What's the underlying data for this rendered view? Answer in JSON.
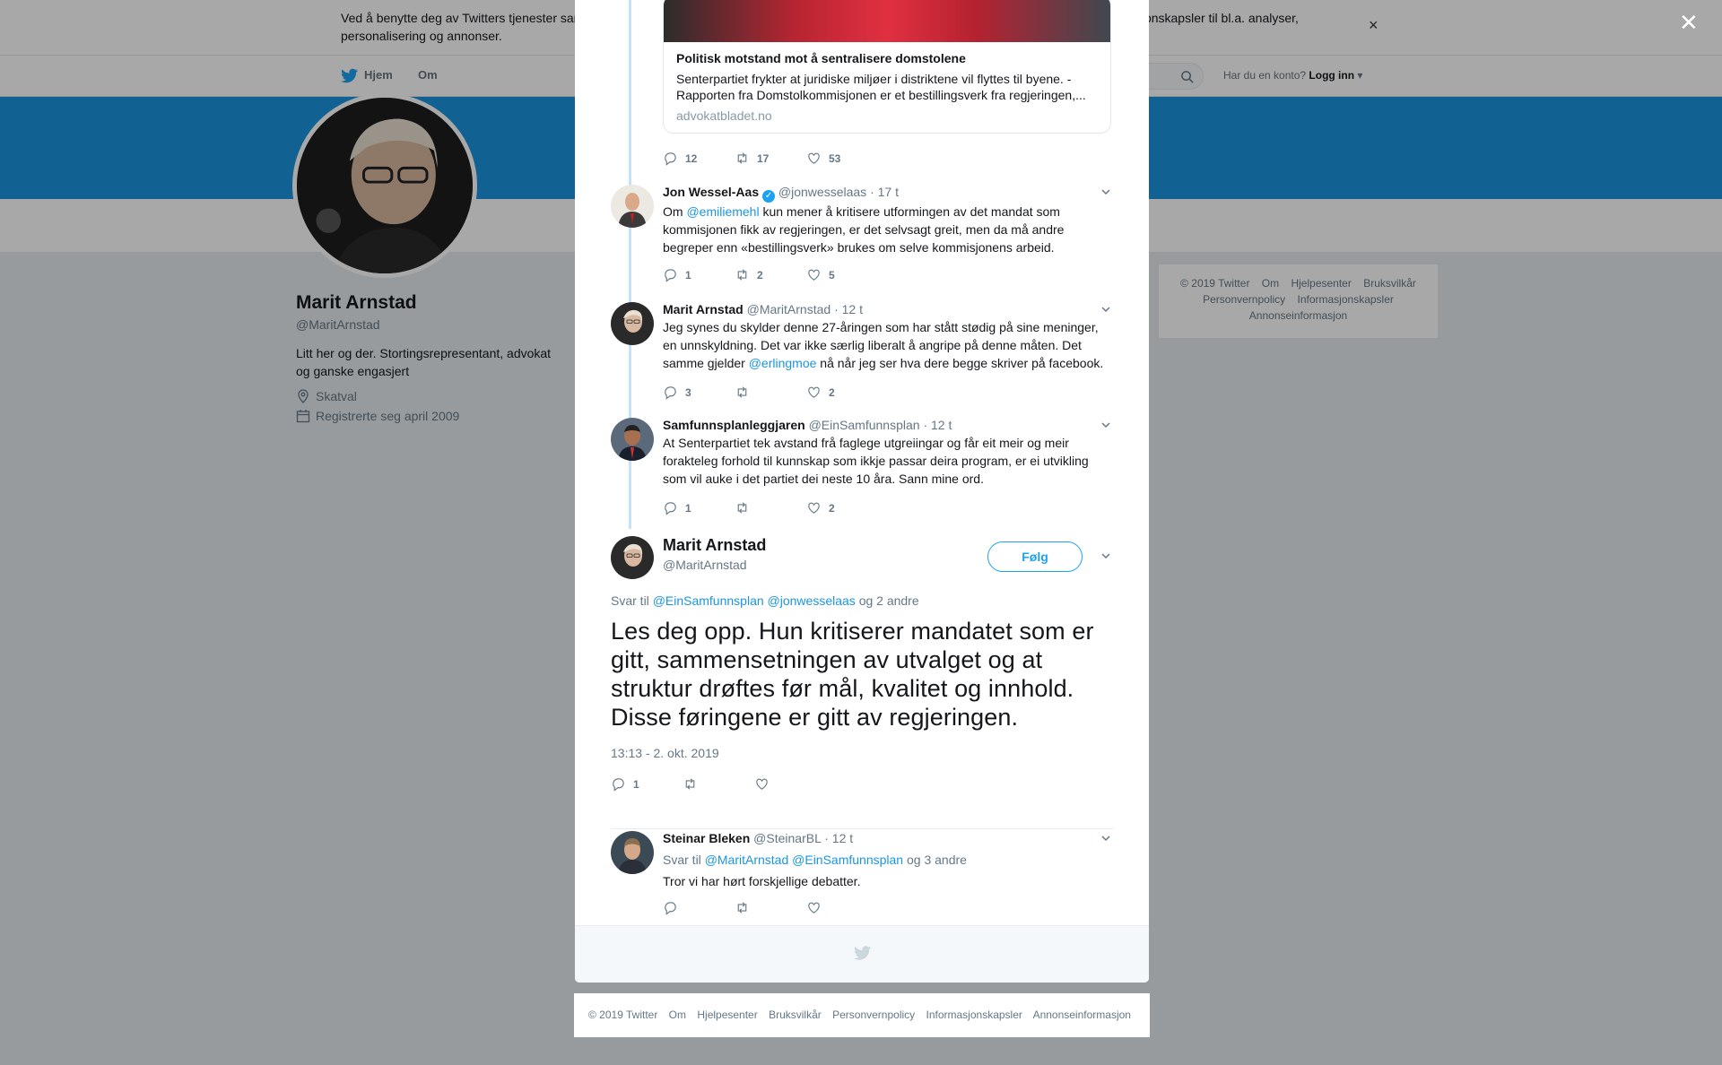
{
  "cookie_banner": {
    "text": "Ved å benytte deg av Twitters tjenester samtykker du i vår bruk av informasjonskapsler. Twitter og partnere fungerer globalt og benytter informasjonskapsler til bl.a. analyser, personalisering og annonser."
  },
  "topnav": {
    "home": "Hjem",
    "about": "Om",
    "login_question": "Har du en konto?",
    "login": "Logg inn"
  },
  "profile": {
    "name": "Marit Arnstad",
    "handle": "@MaritArnstad",
    "bio": "Litt her og der. Stortingsrepresentant, advokat og ganske engasjert",
    "location": "Skatval",
    "joined": "Registrerte seg april 2009"
  },
  "right_footer": [
    "© 2019 Twitter",
    "Om",
    "Hjelpesenter",
    "Bruksvilkår",
    "Personvernpolicy",
    "Informasjonskapsler",
    "Annonseinformasjon"
  ],
  "link_card": {
    "title": "Politisk motstand mot å sentralisere domstolene",
    "description": "Senterpartiet frykter at juridiske miljøer i distriktene vil flyttes til byene. - Rapporten fra Domstolkommisjonen er et bestillingsverk fra regjeringen,...",
    "domain": "advokatbladet.no"
  },
  "first_actions": {
    "replies": "12",
    "retweets": "17",
    "likes": "53"
  },
  "tweets": [
    {
      "name": "Jon Wessel-Aas",
      "handle": "@jonwesselaas",
      "time": "· 17 t",
      "text_pre": "Om ",
      "mention": "@emiliemehl",
      "text_post": " kun mener å kritisere utformingen av det mandat som kommisjonen fikk av regjeringen, er det selvsagt greit, men da må andre begreper enn «bestillingsverk» brukes om selve kommisjonens arbeid.",
      "replies": "1",
      "retweets": "2",
      "likes": "5"
    },
    {
      "name": "Marit Arnstad",
      "handle": "@MaritArnstad",
      "time": "· 12 t",
      "text_pre": "Jeg synes du skylder denne 27-åringen som har stått stødig på sine meninger, en unnskyldning. Det var ikke særlig liberalt å angripe på denne måten. Det samme gjelder ",
      "mention": "@erlingmoe",
      "text_post": " nå når jeg ser hva dere begge skriver på facebook.",
      "replies": "3",
      "retweets": "",
      "likes": "2"
    },
    {
      "name": "Samfunnsplanleggjaren",
      "handle": "@EinSamfunnsplan",
      "time": "· 12 t",
      "text_pre": "At Senterpartiet tek avstand frå faglege utgreiingar og får eit meir og meir forakteleg forhold til kunnskap som ikkje passar deira program, er ei utvikling som vil auke i det partiet dei neste 10 åra. Sann mine ord.",
      "mention": "",
      "text_post": "",
      "replies": "1",
      "retweets": "",
      "likes": "2"
    }
  ],
  "main_tweet": {
    "name": "Marit Arnstad",
    "handle": "@MaritArnstad",
    "follow": "Følg",
    "reply_prefix": "Svar til",
    "reply_mentions": "@EinSamfunnsplan @jonwesselaas",
    "reply_suffix": "og 2 andre",
    "text": "Les deg opp. Hun kritiserer mandatet som er gitt, sammensetningen av utvalget og at struktur drøftes før mål, kvalitet og innhold. Disse føringene er gitt av regjeringen.",
    "timestamp": "13:13 - 2. okt. 2019",
    "replies": "1"
  },
  "reply_tweet": {
    "name": "Steinar Bleken",
    "handle": "@SteinarBL",
    "time": "· 12 t",
    "reply_prefix": "Svar til",
    "reply_mentions": "@MaritArnstad @EinSamfunnsplan",
    "reply_suffix": "og 3 andre",
    "text": "Tror vi har hørt forskjellige debatter."
  },
  "bottom_footer": [
    "© 2019 Twitter",
    "Om",
    "Hjelpesenter",
    "Bruksvilkår",
    "Personvernpolicy",
    "Informasjonskapsler",
    "Annonseinformasjon"
  ],
  "colors": {
    "accent": "#1da1f2",
    "banner": "#1b95e0",
    "muted": "#657786"
  }
}
